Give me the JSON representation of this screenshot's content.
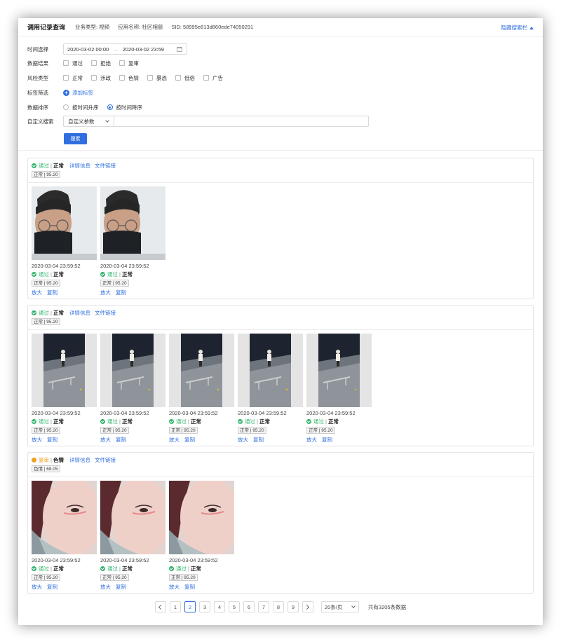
{
  "header": {
    "title": "调用记录查询",
    "business_type": "业务类型: 视频",
    "app_name": "应用名称: 社区相册",
    "sid": "SID: 58995e813d860ede74050291",
    "hide_label": "隐藏搜索栏"
  },
  "filters": {
    "time_label": "时间选择",
    "time_start": "2020-03-02 00:00",
    "time_end": "2020-03-02 23:59",
    "result_label": "数据结果",
    "result_options": [
      "通过",
      "拒绝",
      "复审"
    ],
    "risk_label": "风险类型",
    "risk_options": [
      "正常",
      "涉政",
      "色情",
      "暴恐",
      "低俗",
      "广告"
    ],
    "tag_label": "标签筛选",
    "add_tag": "添加标签",
    "sort_label": "数据排序",
    "sort_asc": "按时间升序",
    "sort_desc": "按时间降序",
    "sort_selected": "desc",
    "custom_label": "自定义搜索",
    "custom_select": "自定义参数",
    "custom_value": "",
    "search_button": "搜索"
  },
  "records": [
    {
      "status": "通过",
      "status_color": "#2fb36b",
      "category": "正常",
      "tag": "正常 | 95.20",
      "details_link": "详情信息",
      "file_link": "文件链接",
      "items": [
        {
          "time": "2020-03-04 23:59:52",
          "status": "通过",
          "category": "正常",
          "tag": "正常 | 95.20",
          "zoom": "放大",
          "copy": "复制",
          "thumb": "face"
        },
        {
          "time": "2020-03-04 23:59:52",
          "status": "通过",
          "category": "正常",
          "tag": "正常 | 95.20",
          "zoom": "放大",
          "copy": "复制",
          "thumb": "face"
        }
      ]
    },
    {
      "status": "通过",
      "status_color": "#2fb36b",
      "category": "正常",
      "tag": "正常 | 95.20",
      "details_link": "详情信息",
      "file_link": "文件链接",
      "items": [
        {
          "time": "2020-03-04 23:59:52",
          "status": "通过",
          "category": "正常",
          "tag": "正常 | 95.20",
          "zoom": "放大",
          "copy": "复制",
          "thumb": "skate"
        },
        {
          "time": "2020-03-04 23:59:52",
          "status": "通过",
          "category": "正常",
          "tag": "正常 | 95.20",
          "zoom": "放大",
          "copy": "复制",
          "thumb": "skate"
        },
        {
          "time": "2020-03-04 23:59:52",
          "status": "通过",
          "category": "正常",
          "tag": "正常 | 95.20",
          "zoom": "放大",
          "copy": "复制",
          "thumb": "skate"
        },
        {
          "time": "2020-03-04 23:59:52",
          "status": "通过",
          "category": "正常",
          "tag": "正常 | 95.20",
          "zoom": "放大",
          "copy": "复制",
          "thumb": "skate"
        },
        {
          "time": "2020-03-04 23:59:52",
          "status": "通过",
          "category": "正常",
          "tag": "正常 | 95.20",
          "zoom": "放大",
          "copy": "复制",
          "thumb": "skate"
        }
      ]
    },
    {
      "status": "复审",
      "status_color": "#f0a020",
      "category": "色情",
      "tag": "色情 | 68.05",
      "details_link": "详情信息",
      "file_link": "文件链接",
      "items": [
        {
          "time": "2020-03-04 23:59:52",
          "status": "通过",
          "category": "正常",
          "tag": "正常 | 95.20",
          "zoom": "放大",
          "copy": "复制",
          "thumb": "selfie"
        },
        {
          "time": "2020-03-04 23:59:52",
          "status": "通过",
          "category": "正常",
          "tag": "正常 | 95.20",
          "zoom": "放大",
          "copy": "复制",
          "thumb": "selfie"
        },
        {
          "time": "2020-03-04 23:59:52",
          "status": "通过",
          "category": "正常",
          "tag": "正常 | 95.20",
          "zoom": "放大",
          "copy": "复制",
          "thumb": "selfie"
        }
      ]
    }
  ],
  "pagination": {
    "pages": [
      "1",
      "2",
      "3",
      "4",
      "5",
      "6",
      "7",
      "8",
      "9"
    ],
    "current": "2",
    "page_size": "20条/页",
    "total": "共有3205条数据"
  }
}
